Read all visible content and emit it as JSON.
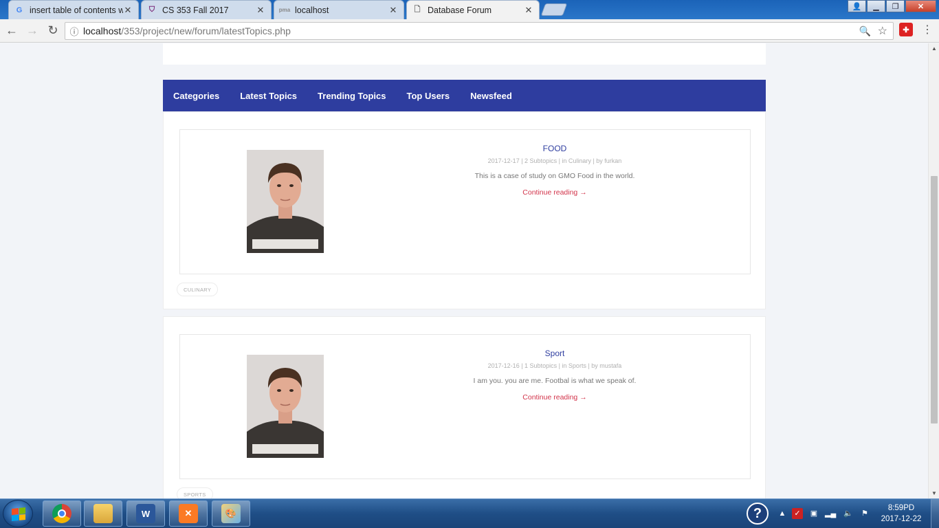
{
  "browser": {
    "tabs": [
      {
        "title": "insert table of contents w",
        "icon": "google-icon",
        "active": false
      },
      {
        "title": "CS 353 Fall 2017",
        "icon": "shield-icon",
        "active": false
      },
      {
        "title": "localhost",
        "icon": "phpmyadmin-icon",
        "active": false
      },
      {
        "title": "Database Forum",
        "icon": "page-icon",
        "active": true
      }
    ],
    "url_host": "localhost",
    "url_path": "/353/project/new/forum/latestTopics.php"
  },
  "site": {
    "nav": [
      "Categories",
      "Latest Topics",
      "Trending Topics",
      "Top Users",
      "Newsfeed"
    ],
    "accent_color": "#2e3d9f",
    "link_color": "#d2334a"
  },
  "topics": [
    {
      "title": "FOOD",
      "date": "2017-12-17",
      "subtopics": "2 Subtopics",
      "category": "in Culinary",
      "author": "by furkan",
      "description": "This is a case of study on GMO Food in the world.",
      "continue": "Continue reading →",
      "tag": "CULINARY"
    },
    {
      "title": "Sport",
      "date": "2017-12-16",
      "subtopics": "1 Subtopics",
      "category": "in Sports",
      "author": "by mustafa",
      "description": "I am you. you are me. Footbal is what we speak of.",
      "continue": "Continue reading →",
      "tag": "SPORTS"
    }
  ],
  "taskbar": {
    "time": "8:59PD",
    "date": "2017-12-22"
  }
}
